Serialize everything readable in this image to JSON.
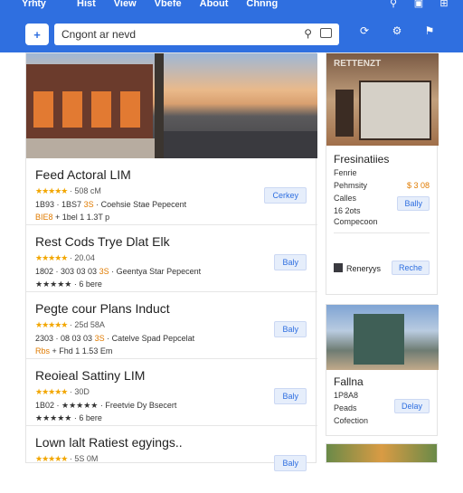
{
  "header": {
    "brand": "Yrhty",
    "menu": [
      "Hist",
      "View",
      "Vbefe",
      "About",
      "Chnng"
    ],
    "search_value": "Cngont ar nevd",
    "accent": "#2f6fe0"
  },
  "icons": {
    "top": [
      "search-icon",
      "folder-icon",
      "grid-icon"
    ],
    "right": [
      "refresh-icon",
      "settings-icon",
      "filter-icon"
    ]
  },
  "results": [
    {
      "title": "Feed Actoral LIM",
      "rating": "★★★★★",
      "rating_text": "· 508 cM",
      "line1_a": "1B93 · 1BS7",
      "line1_b": "3S",
      "line1_c": "· Coehsie Stae Pepecent",
      "line2_a": "BIE8",
      "line2_b": "+ 1bel 1 1.3T p",
      "cta": "Cerkey"
    },
    {
      "title": "Rest Cods Trye Dlat Elk",
      "rating": "★★★★★",
      "rating_text": "· 20.04",
      "line1_a": "1802 · 303 03 03",
      "line1_b": "3S",
      "line1_c": "· Geentya Star Pepecent",
      "line2_a": "",
      "line2_b": "★★★★★ · 6 bere",
      "cta": "Baly"
    },
    {
      "title": "Pegte cour Plans Induct",
      "rating": "★★★★★",
      "rating_text": "· 25d 58A",
      "line1_a": "2303 · 08 03 03",
      "line1_b": "3S",
      "line1_c": "· Catelve Spad Pepcelat",
      "line2_a": "Rbs",
      "line2_b": "+ Fhd 1 1.53 Em",
      "cta": "Baly"
    },
    {
      "title": "Reoieal Sattiny LIM",
      "rating": "★★★★★",
      "rating_text": "· 30D",
      "line1_a": "1B02 · ★★★★★",
      "line1_b": "",
      "line1_c": "· Freetvie Dy Bsecert",
      "line2_a": "",
      "line2_b": "★★★★★ · 6 bere",
      "cta": "Baly"
    },
    {
      "title": "Lown lalt Ratiest egyings..",
      "rating": "★★★★★",
      "rating_text": "· 5S 0M",
      "line1_a": "",
      "line1_b": "",
      "line1_c": "",
      "line2_a": "",
      "line2_b": "",
      "cta": "Baly"
    }
  ],
  "side_card_1": {
    "sign": "RETTENZT",
    "title": "Fresinatiies",
    "line1": "Fenrie",
    "line2": "Pehmsity",
    "price": "$ 3 08",
    "line3": "Calles",
    "line4": "16 2ots",
    "line5": "Compecoon",
    "cta1": "Bally",
    "flag_label": "Reneryys",
    "cta2": "Reche"
  },
  "side_card_2": {
    "title": "Fallna",
    "line1": "1P8A8",
    "line2": "Peads",
    "line3": "Cofection",
    "cta": "Delay"
  }
}
